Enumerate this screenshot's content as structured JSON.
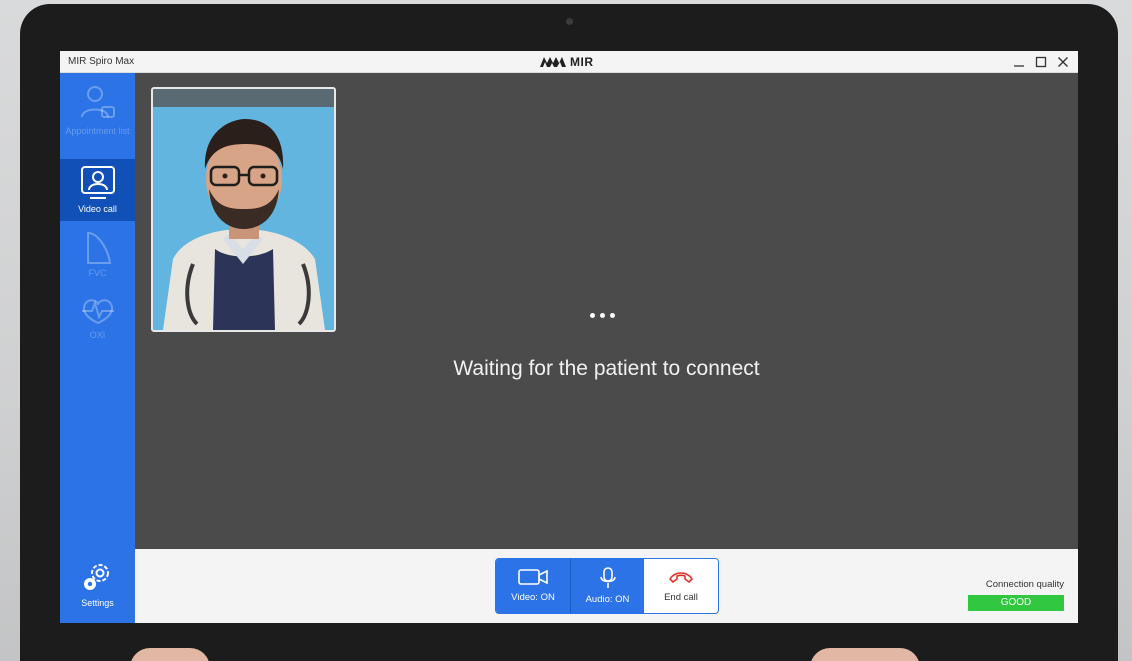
{
  "window": {
    "app_title": "MIR Spiro Max",
    "brand": "MIR"
  },
  "sidebar": {
    "items": [
      {
        "label": "Appointment list",
        "icon": "appointment-list-icon",
        "state": "disabled"
      },
      {
        "label": "Video call",
        "icon": "video-call-icon",
        "state": "active"
      },
      {
        "label": "FVC",
        "icon": "fvc-icon",
        "state": "disabled"
      },
      {
        "label": "OXI",
        "icon": "oxi-icon",
        "state": "disabled"
      }
    ],
    "settings_label": "Settings"
  },
  "call": {
    "status_text": "Waiting for the patient to connect",
    "loading_indicator": "•••"
  },
  "controls": {
    "video_label": "Video: ON",
    "audio_label": "Audio: ON",
    "end_call_label": "End call"
  },
  "connection": {
    "label": "Connection quality",
    "value": "GOOD"
  },
  "colors": {
    "accent": "#2b73e6",
    "sidebar_active": "#1050b7",
    "main_bg": "#4b4b4c",
    "good": "#32c740",
    "end_call": "#e0322c"
  }
}
